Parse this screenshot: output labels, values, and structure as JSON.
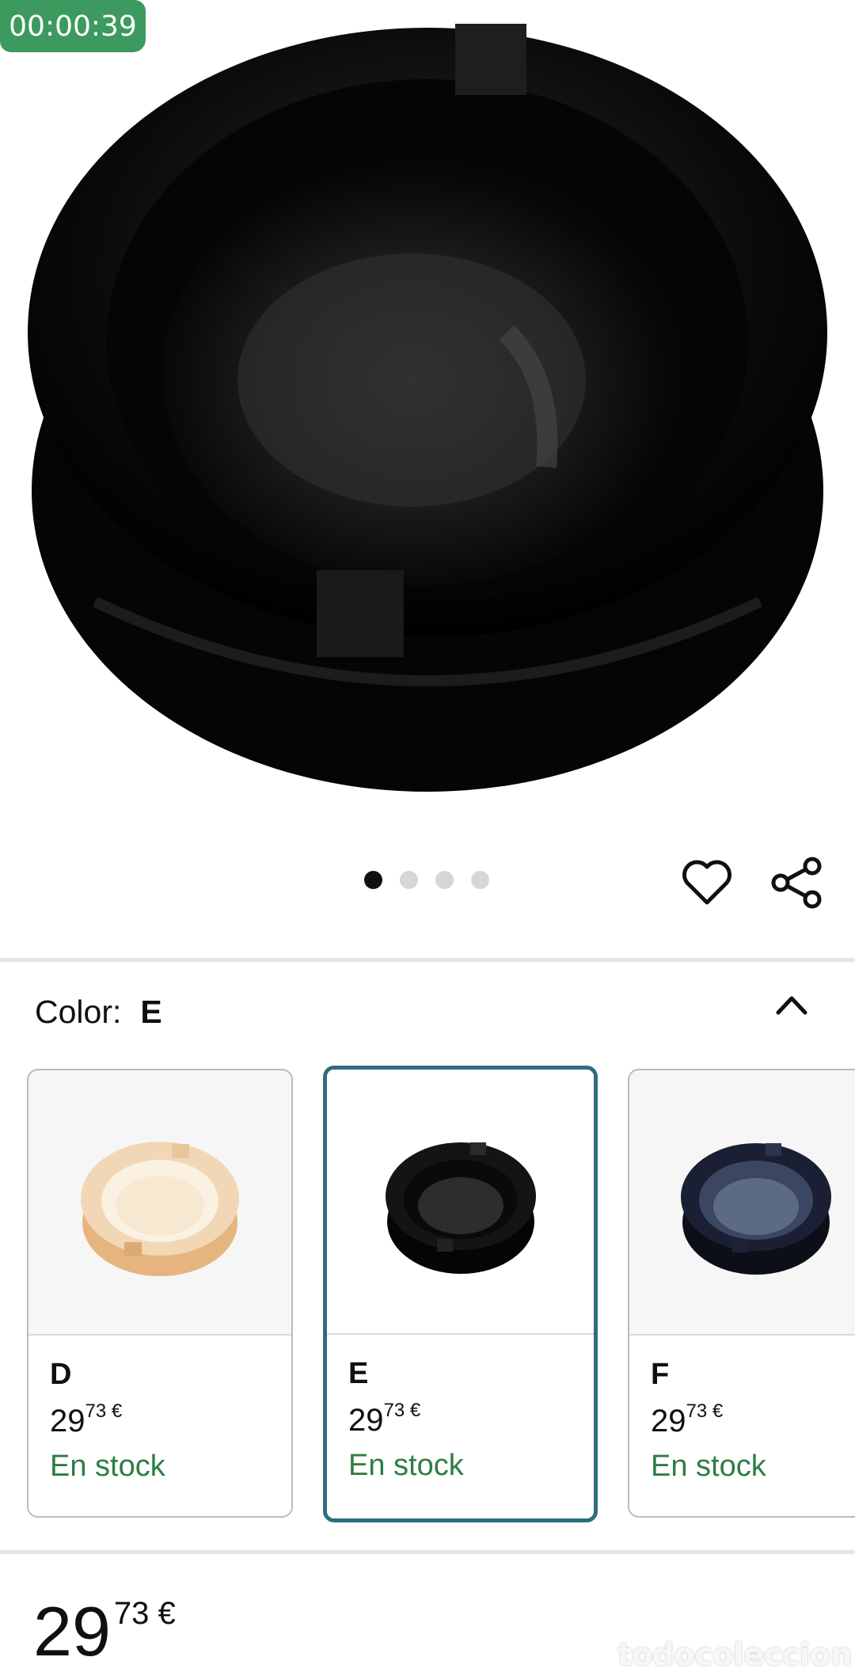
{
  "timer": "00:00:39",
  "gallery": {
    "dot_count": 4,
    "active_index": 0
  },
  "variation": {
    "label": "Color:",
    "selected": "E"
  },
  "options": [
    {
      "name": "D",
      "price_whole": "29",
      "price_fraction": "73",
      "currency": "€",
      "stock": "En stock",
      "selected": false,
      "style": "amber"
    },
    {
      "name": "E",
      "price_whole": "29",
      "price_fraction": "73",
      "currency": "€",
      "stock": "En stock",
      "selected": true,
      "style": "black"
    },
    {
      "name": "F",
      "price_whole": "29",
      "price_fraction": "73",
      "currency": "€",
      "stock": "En stock",
      "selected": false,
      "style": "navy"
    }
  ],
  "price": {
    "whole": "29",
    "fraction": "73",
    "currency": "€"
  },
  "watermark": "todocoleccion",
  "icons": {
    "wishlist": "heart-icon",
    "share": "share-icon",
    "collapse": "chevron-up-icon"
  },
  "colors": {
    "stock_green": "#2e7d42",
    "selected_border": "#2d6e7e",
    "timer_green": "#3c9a5f"
  }
}
